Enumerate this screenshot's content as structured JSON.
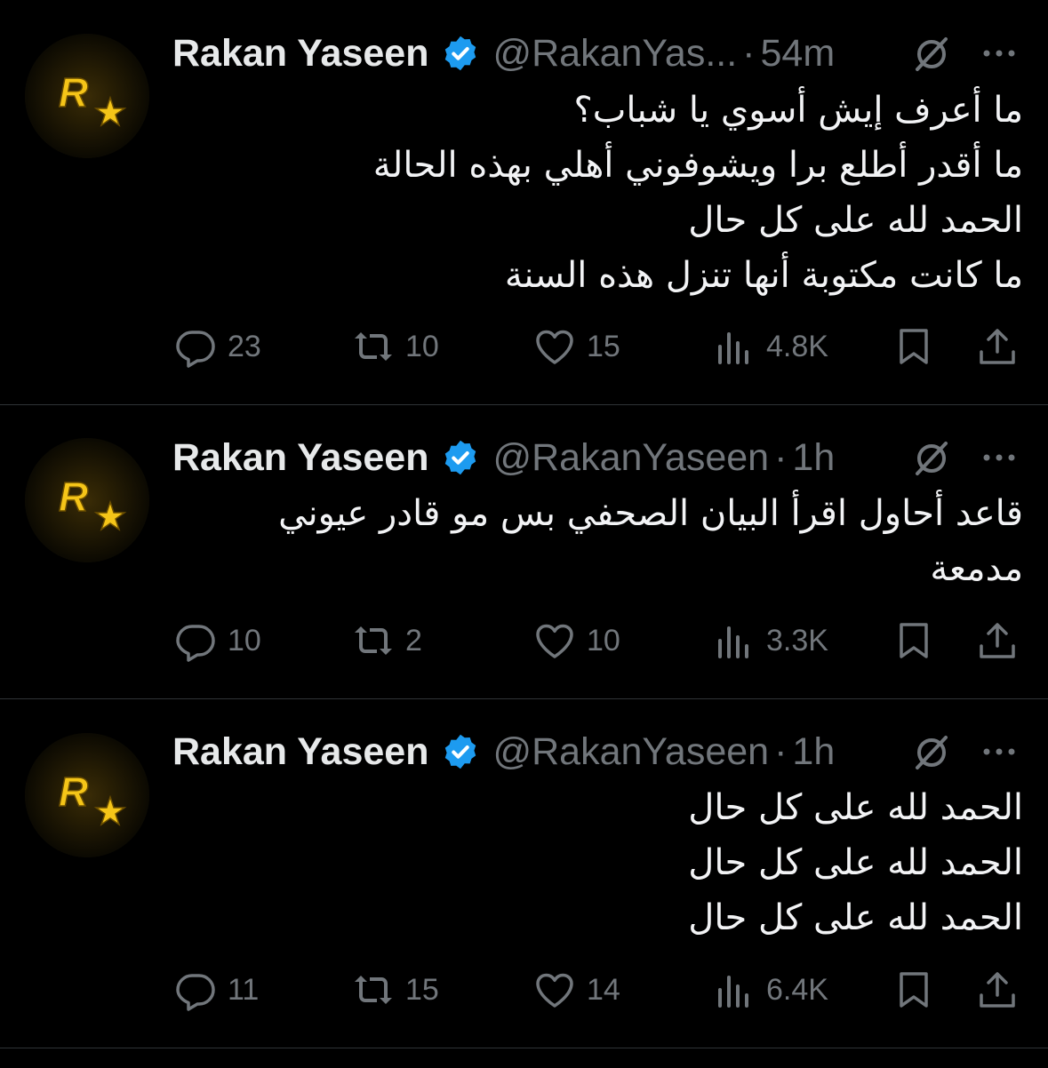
{
  "colors": {
    "background": "#000000",
    "text": "#e7e9ea",
    "muted": "#71767b",
    "verified": "#1d9bf0",
    "divider": "#2f3336",
    "avatar_accent": "#f5c518"
  },
  "tweets": [
    {
      "name": "Rakan Yaseen",
      "handle": "@RakanYas...",
      "separator": "·",
      "time": "54m",
      "lines": [
        "ما أعرف إيش أسوي يا شباب؟",
        "ما أقدر أطلع برا ويشوفوني أهلي بهذه الحالة",
        "الحمد لله على كل حال",
        "ما كانت مكتوبة أنها تنزل هذه السنة"
      ],
      "replies": "23",
      "reposts": "10",
      "likes": "15",
      "views": "4.8K"
    },
    {
      "name": "Rakan Yaseen",
      "handle": "@RakanYaseen",
      "separator": "·",
      "time": "1h",
      "lines": [
        "قاعد أحاول اقرأ البيان الصحفي بس مو قادر عيوني",
        "مدمعة"
      ],
      "replies": "10",
      "reposts": "2",
      "likes": "10",
      "views": "3.3K"
    },
    {
      "name": "Rakan Yaseen",
      "handle": "@RakanYaseen",
      "separator": "·",
      "time": "1h",
      "lines": [
        "الحمد لله على كل حال",
        "الحمد لله على كل حال",
        "الحمد لله على كل حال"
      ],
      "replies": "11",
      "reposts": "15",
      "likes": "14",
      "views": "6.4K"
    }
  ],
  "icons": {
    "avatar": "rockstar-logo-icon",
    "verified": "verified-badge-icon",
    "grok": "grok-icon",
    "more": "more-icon",
    "reply": "reply-icon",
    "repost": "repost-icon",
    "like": "heart-icon",
    "views": "views-icon",
    "bookmark": "bookmark-icon",
    "share": "share-icon"
  }
}
